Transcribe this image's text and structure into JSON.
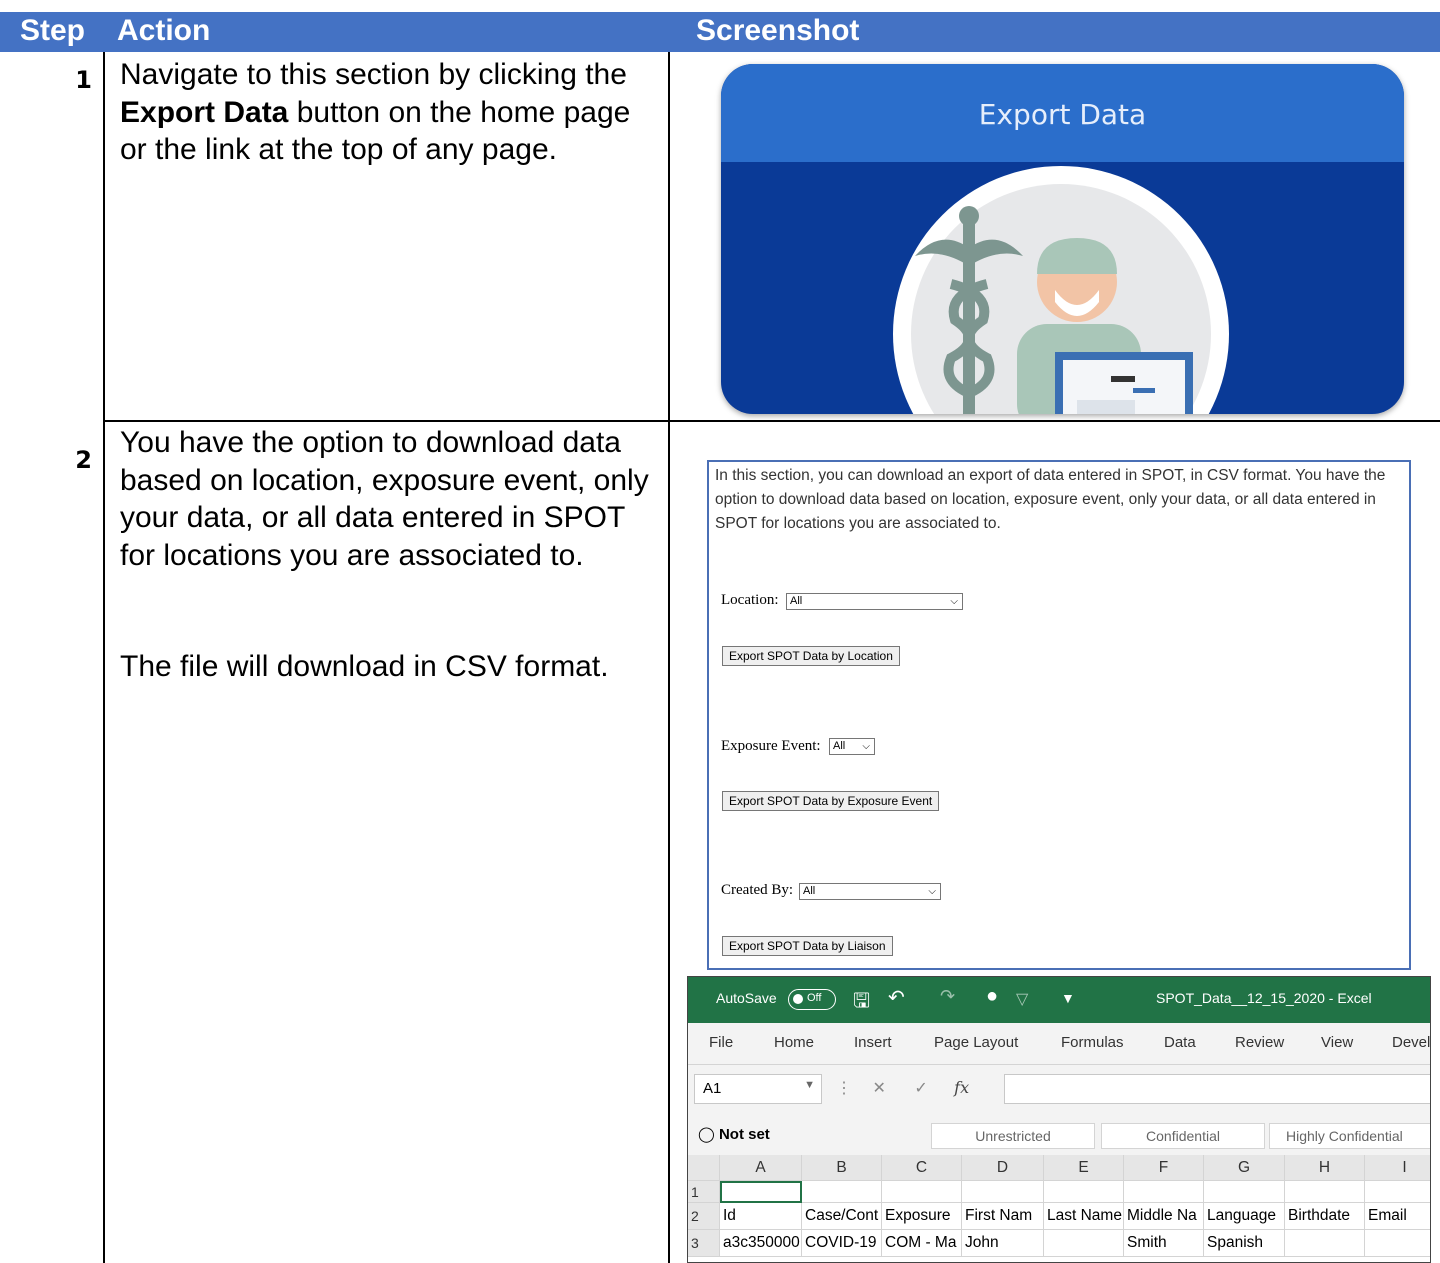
{
  "table": {
    "headers": [
      "Step",
      "Action",
      "Screenshot"
    ],
    "rows": [
      {
        "step": "1",
        "action_prefix": "Navigate to this section by clicking the ",
        "action_bold": "Export Data",
        "action_suffix": " button on the home page or the link at the top of any page."
      },
      {
        "step": "2",
        "action_p1": "You have the option to download data based on location, exposure event, only your data, or all data entered in SPOT for locations you are associated to.",
        "action_p2": "The file will download in CSV format."
      }
    ]
  },
  "tile": {
    "title": "Export Data"
  },
  "export_form": {
    "intro": "In this section, you can download an export of data entered in SPOT, in CSV format. You have the option to download data based on location, exposure event, only your data, or all data entered in SPOT for locations you are associated to.",
    "location_label": "Location:",
    "location_value": "All",
    "location_button": "Export SPOT Data by Location",
    "exposure_label": "Exposure Event:",
    "exposure_value": "All",
    "exposure_button": "Export SPOT Data by Exposure Event",
    "created_label": "Created By:",
    "created_value": "All",
    "created_button": "Export SPOT Data by Liaison"
  },
  "excel": {
    "autosave": "AutoSave",
    "toggle": "Off",
    "filename": "SPOT_Data__12_15_2020  -  Excel",
    "tabs": [
      "File",
      "Home",
      "Insert",
      "Page Layout",
      "Formulas",
      "Data",
      "Review",
      "View",
      "Devel"
    ],
    "namebox": "A1",
    "fx": "fx",
    "sensitivity": {
      "current": "Not set",
      "labels": [
        "Unrestricted",
        "Confidential",
        "Highly Confidential"
      ]
    },
    "columns": [
      "A",
      "B",
      "C",
      "D",
      "E",
      "F",
      "G",
      "H",
      "I"
    ],
    "rows": [
      {
        "num": "1",
        "cells": [
          "",
          "",
          "",
          "",
          "",
          "",
          "",
          "",
          ""
        ]
      },
      {
        "num": "2",
        "cells": [
          "Id",
          "Case/Cont",
          "Exposure",
          "First Nam",
          "Last Name",
          "Middle Na",
          "Language",
          "Birthdate",
          "Email"
        ]
      },
      {
        "num": "3",
        "cells": [
          "a3c350000",
          "COVID-19",
          "COM - Ma",
          "John",
          "",
          "Smith",
          "Spanish",
          "",
          ""
        ]
      }
    ]
  }
}
